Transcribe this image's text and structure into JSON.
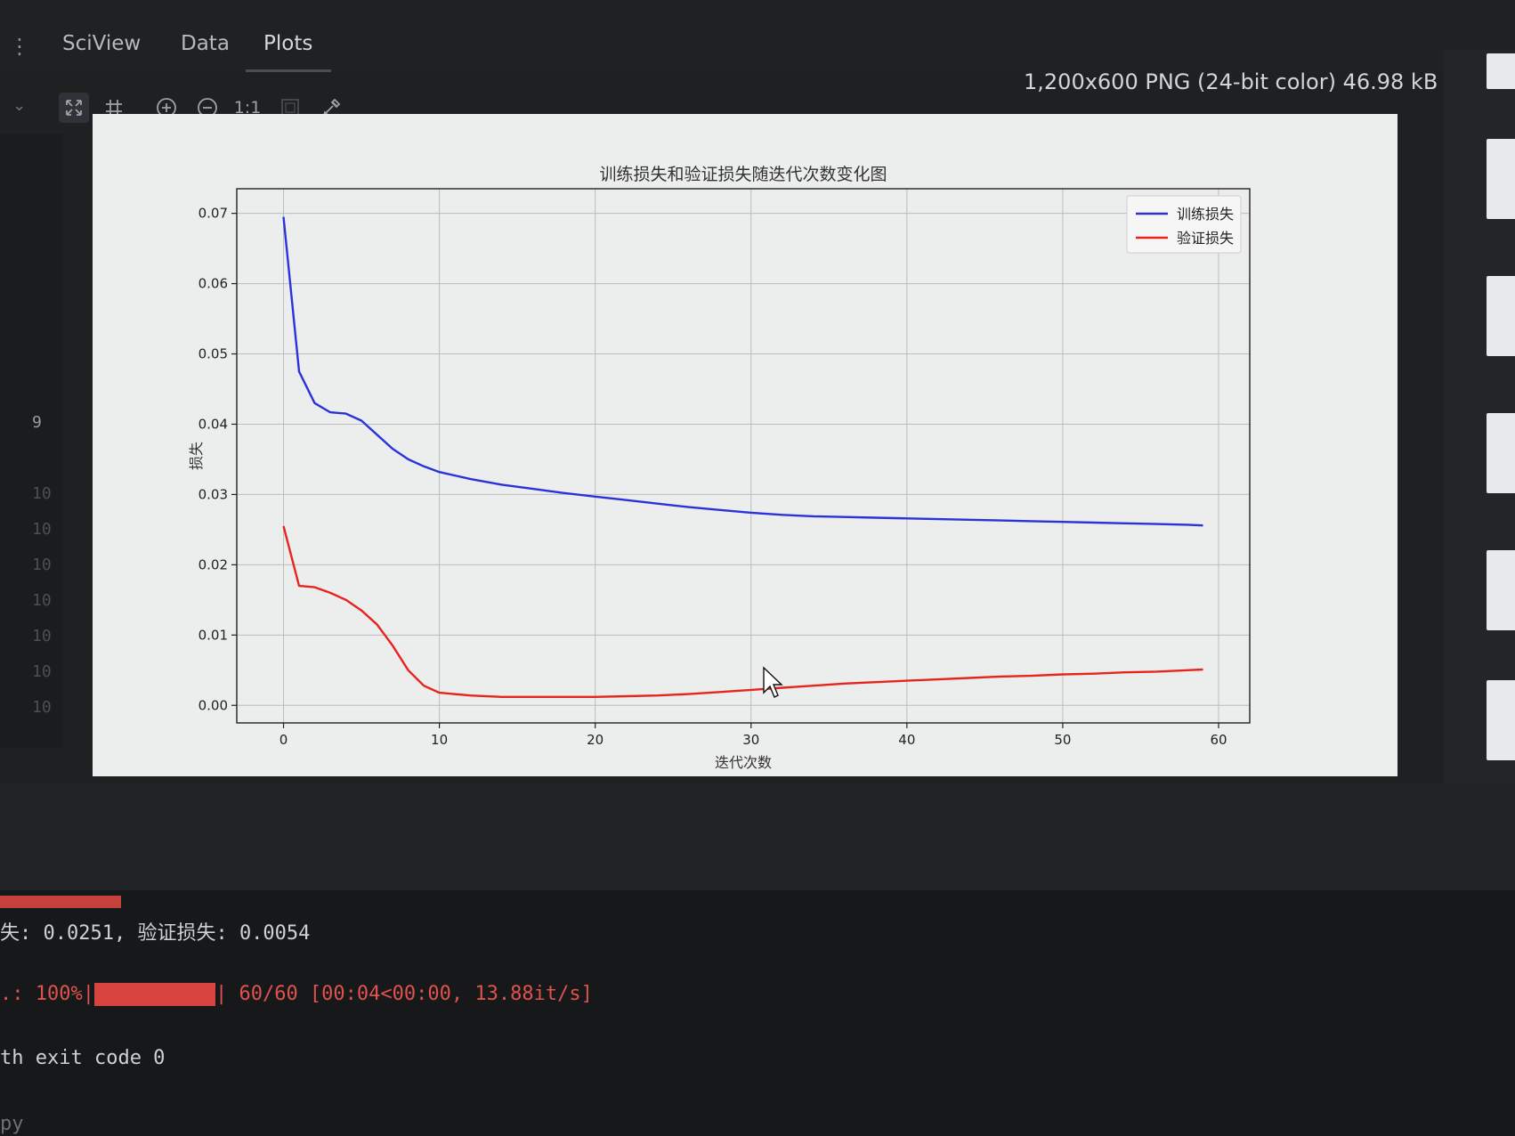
{
  "tabs": {
    "sciview": "SciView",
    "data": "Data",
    "plots": "Plots"
  },
  "toolbar": {
    "actual_size_label": "1:1",
    "image_info": "1,200x600 PNG (24-bit color) 46.98 kB",
    "icons": [
      "fit-icon",
      "grid-icon",
      "zoom-in-icon",
      "zoom-out-icon",
      "background-icon",
      "color-picker-icon"
    ]
  },
  "gutter": {
    "current_line": "9",
    "lines": [
      "10",
      "10",
      "10",
      "10",
      "10",
      "10",
      "10"
    ]
  },
  "chart_data": {
    "type": "line",
    "title": "训练损失和验证损失随迭代次数变化图",
    "xlabel": "迭代次数",
    "ylabel": "损失",
    "xlim": [
      -3,
      62
    ],
    "ylim": [
      -0.0025,
      0.0735
    ],
    "xticks": [
      0,
      10,
      20,
      30,
      40,
      50,
      60
    ],
    "yticks": [
      0.0,
      0.01,
      0.02,
      0.03,
      0.04,
      0.05,
      0.06,
      0.07
    ],
    "ytick_labels": [
      "0.00",
      "0.01",
      "0.02",
      "0.03",
      "0.04",
      "0.05",
      "0.06",
      "0.07"
    ],
    "grid": true,
    "legend_position": "top-right",
    "series": [
      {
        "name": "训练损失",
        "color": "#2a33d9",
        "x": [
          0,
          1,
          2,
          3,
          4,
          5,
          6,
          7,
          8,
          9,
          10,
          12,
          14,
          16,
          18,
          20,
          22,
          24,
          26,
          28,
          30,
          32,
          34,
          36,
          38,
          40,
          42,
          44,
          46,
          48,
          50,
          52,
          54,
          56,
          58,
          59
        ],
        "y": [
          0.0695,
          0.0475,
          0.043,
          0.0417,
          0.0415,
          0.0405,
          0.0385,
          0.0365,
          0.035,
          0.034,
          0.0332,
          0.0322,
          0.0314,
          0.0308,
          0.0302,
          0.0297,
          0.0292,
          0.0287,
          0.0282,
          0.0278,
          0.0274,
          0.0271,
          0.0269,
          0.0268,
          0.0267,
          0.0266,
          0.0265,
          0.0264,
          0.0263,
          0.0262,
          0.0261,
          0.026,
          0.0259,
          0.0258,
          0.0257,
          0.0256
        ]
      },
      {
        "name": "验证损失",
        "color": "#e5251e",
        "x": [
          0,
          1,
          2,
          3,
          4,
          5,
          6,
          7,
          8,
          9,
          10,
          12,
          14,
          16,
          18,
          20,
          22,
          24,
          26,
          28,
          30,
          32,
          34,
          36,
          38,
          40,
          42,
          44,
          46,
          48,
          50,
          52,
          54,
          56,
          58,
          59
        ],
        "y": [
          0.0255,
          0.017,
          0.0168,
          0.016,
          0.015,
          0.0135,
          0.0115,
          0.0085,
          0.005,
          0.0028,
          0.0018,
          0.0014,
          0.0012,
          0.0012,
          0.0012,
          0.0012,
          0.0013,
          0.0014,
          0.0016,
          0.0019,
          0.0022,
          0.0025,
          0.0028,
          0.0031,
          0.0033,
          0.0035,
          0.0037,
          0.0039,
          0.0041,
          0.0042,
          0.0044,
          0.0045,
          0.0047,
          0.0048,
          0.005,
          0.0051
        ]
      }
    ]
  },
  "console": {
    "line1_prefix": "失: 0.0251, 验证损失: 0.0054",
    "line2_prefix": ".: 100%|",
    "line2_suffix": "| 60/60 [00:04<00:00, 13.88it/s]",
    "line3": "th exit code 0",
    "line4": "py"
  }
}
